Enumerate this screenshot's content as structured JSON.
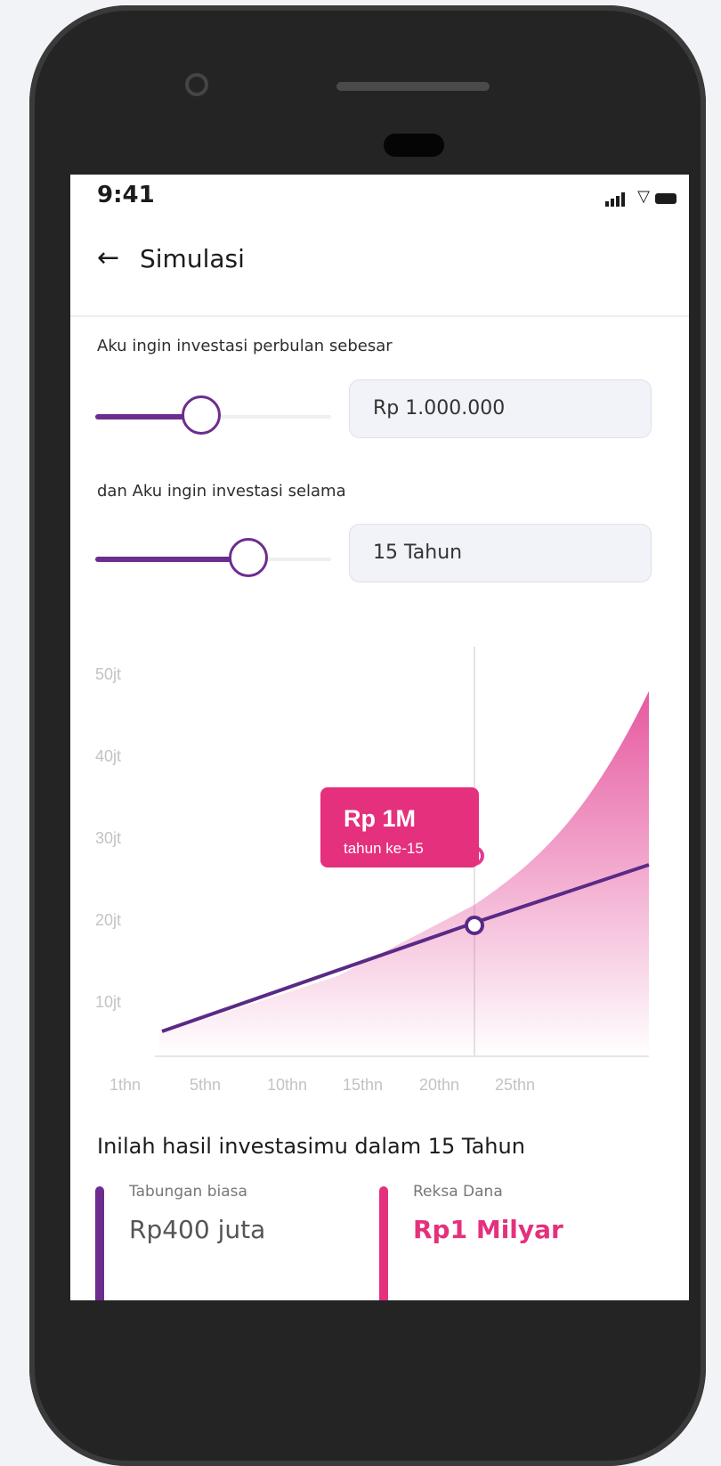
{
  "status_bar": {
    "time": "9:41"
  },
  "header": {
    "title": "Simulasi"
  },
  "form": {
    "monthly_label": "Aku ingin investasi perbulan sebesar",
    "monthly_value": "Rp 1.000.000",
    "monthly_slider_level": 0.45,
    "duration_label": "dan Aku ingin investasi selama",
    "duration_value": "15 Tahun",
    "duration_slider_level": 0.65
  },
  "chart_data": {
    "type": "area",
    "y_ticks": [
      "10jt",
      "20jt",
      "30jt",
      "40jt",
      "50jt"
    ],
    "x_ticks": [
      "1thn",
      "5thn",
      "10thn",
      "15thn",
      "20thn",
      "25thn"
    ],
    "series": [
      {
        "color": "#e23b8f",
        "style": "area"
      },
      {
        "color": "#5a2a86",
        "style": "line"
      }
    ],
    "tooltip": {
      "value": "Rp 1M",
      "subtitle": "tahun ke-15"
    }
  },
  "result": {
    "title": "Inilah hasil investasimu dalam 15 Tahun",
    "savings": {
      "label": "Tabungan biasa",
      "value": "Rp400 juta",
      "color": "#6c2d8f"
    },
    "mutual_fund": {
      "label": "Reksa Dana",
      "value": "Rp1 Milyar",
      "color": "#e5307d"
    }
  },
  "icons": {
    "back": "back-arrow-icon",
    "signal": "signal-icon",
    "wifi": "wifi-icon",
    "battery": "battery-icon"
  }
}
